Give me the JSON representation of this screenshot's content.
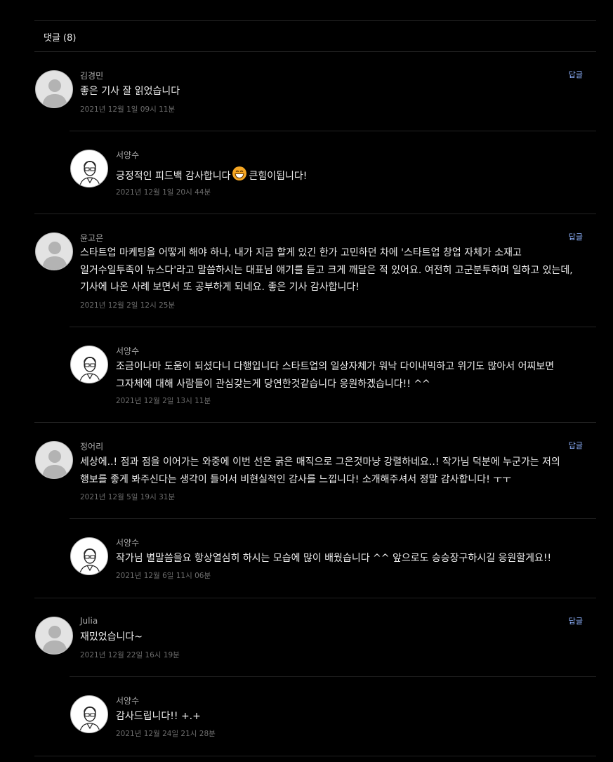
{
  "comments_header": {
    "label": "댓글 (8)"
  },
  "comments": [
    {
      "author": "김경민",
      "lines": [
        "좋은 기사 잘 읽었습니다"
      ],
      "date": "2021년 12월 1일 09시 11분",
      "reply_label": "답글",
      "answer": {
        "author": "서양수",
        "before_emoji": "긍정적인 피드백 감사합니다",
        "emoji": "grinning-face-emoji",
        "after_emoji": "큰힘이됩니다!",
        "date": "2021년 12월 1일 20시 44분"
      }
    },
    {
      "author": "윤고은",
      "lines": [
        "스타트업 마케팅을 어떻게 해야 하나, 내가 지금 할게 있긴 한가 고민하던 차에 '스타트업 창업 자체가 소재고",
        "일거수일투족이 뉴스다'라고 말씀하시는 대표님 얘기를 듣고 크게 깨달은 적 있어요. 여전히 고군분투하며 일하고 있는데,",
        "기사에 나온 사례 보면서 또 공부하게 되네요. 좋은 기사 감사합니다!"
      ],
      "date": "2021년 12월 2일 12시 25분",
      "reply_label": "답글",
      "answer": {
        "author": "서양수",
        "lines": [
          "조금이나마 도움이 되셨다니 다행입니다 스타트업의 일상자체가 워낙 다이내믹하고 위기도 많아서 어찌보면",
          "그자체에 대해 사람들이 관심갖는게 당연한것같습니다 응원하겠습니다!! ^^"
        ],
        "date": "2021년 12월 2일 13시 11분"
      }
    },
    {
      "author": "정어리",
      "lines": [
        "세상에..! 점과 점을 이어가는 와중에 이번 선은 굵은 매직으로 그은것마냥 강렬하네요..! 작가님 덕분에 누군가는 저의",
        "행보를 좋게 봐주신다는 생각이 들어서 비현실적인 감사를 느낍니다! 소개해주셔서 정말 감사합니다! ㅜㅜ"
      ],
      "date": "2021년 12월 5일 19시 31분",
      "reply_label": "답글",
      "answer": {
        "author": "서양수",
        "lines": [
          "작가님 별말씀을요 항상열심히 하시는 모습에 많이 배웠습니다 ^^ 앞으로도 승승장구하시길 응원할게요!!"
        ],
        "date": "2021년 12월 6일 11시 06분"
      }
    },
    {
      "author": "Julia",
      "lines": [
        "재밌었습니다~"
      ],
      "date": "2021년 12월 22일 16시 19분",
      "reply_label": "답글",
      "answer": {
        "author": "서양수",
        "lines": [
          "감사드립니다!! +.+"
        ],
        "date": "2021년 12월 24일 21시 28분"
      }
    }
  ]
}
